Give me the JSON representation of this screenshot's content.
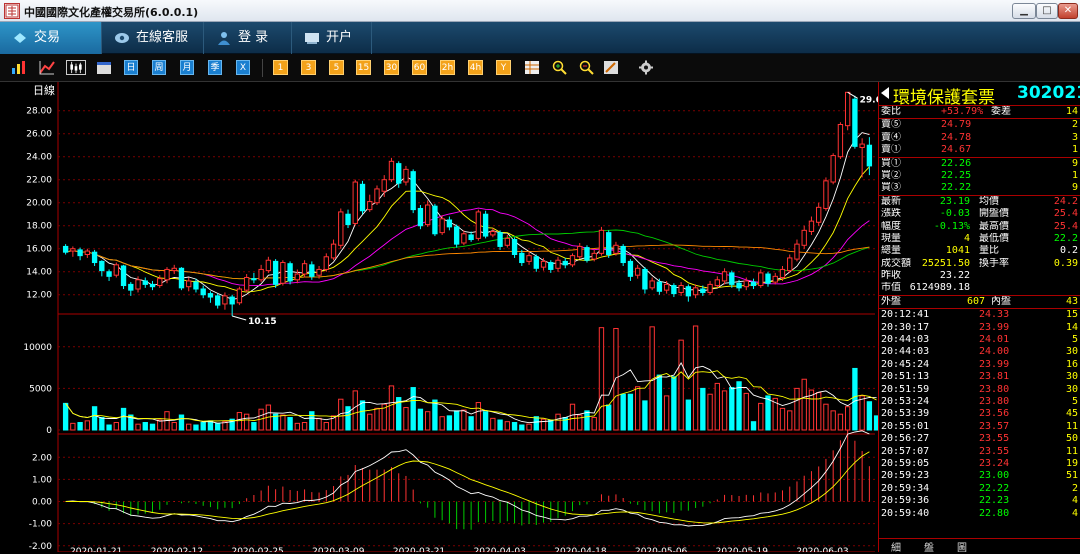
{
  "window": {
    "title": "中國國際文化產權交易所(6.0.0.1)",
    "logo_text": "文交所"
  },
  "nav": [
    {
      "label": "交易",
      "icon": "trade-icon",
      "active": true
    },
    {
      "label": "在線客服",
      "icon": "support-icon",
      "active": false
    },
    {
      "label": "登  录",
      "icon": "user-icon",
      "active": false
    },
    {
      "label": "开户",
      "icon": "account-icon",
      "active": false
    }
  ],
  "toolbar": {
    "periods": [
      "日",
      "周",
      "月",
      "季",
      "X"
    ],
    "minutes": [
      "1",
      "3",
      "5",
      "15",
      "30",
      "60",
      "2h",
      "4h",
      "Y"
    ]
  },
  "chart_data": [
    {
      "type": "candlestick",
      "title": "日線",
      "period_label": "日線",
      "yticks": [
        "28.00",
        "26.00",
        "24.00",
        "22.00",
        "20.00",
        "18.00",
        "16.00",
        "14.00",
        "12.00"
      ],
      "ylim": [
        10.5,
        29.8
      ],
      "x_dates": [
        "2020-01-21",
        "2020-02-12",
        "2020-02-25",
        "2020-03-09",
        "2020-03-21",
        "2020-04-03",
        "2020-04-18",
        "2020-05-06",
        "2020-05-19",
        "2020-06-03"
      ],
      "annotations": {
        "high": "29.6",
        "low": "10.15"
      },
      "candles": [
        [
          16.2,
          15.7,
          16.4,
          15.5
        ],
        [
          15.8,
          16.0,
          16.2,
          15.3
        ],
        [
          15.9,
          15.4,
          16.1,
          15.0
        ],
        [
          15.5,
          15.8,
          16.0,
          15.2
        ],
        [
          15.7,
          14.8,
          15.9,
          14.5
        ],
        [
          14.9,
          14.1,
          15.0,
          13.6
        ],
        [
          14.0,
          13.6,
          14.2,
          13.2
        ],
        [
          13.7,
          14.6,
          14.8,
          13.5
        ],
        [
          14.5,
          12.8,
          14.6,
          12.5
        ],
        [
          12.9,
          12.4,
          13.1,
          11.9
        ],
        [
          12.5,
          13.3,
          13.6,
          12.2
        ],
        [
          13.2,
          12.9,
          13.5,
          12.6
        ],
        [
          12.9,
          12.7,
          13.2,
          12.4
        ],
        [
          12.8,
          13.4,
          13.7,
          12.6
        ],
        [
          13.3,
          14.2,
          14.4,
          13.0
        ],
        [
          14.1,
          14.3,
          14.6,
          13.8
        ],
        [
          14.3,
          12.6,
          14.4,
          12.4
        ],
        [
          12.7,
          13.2,
          13.5,
          12.3
        ],
        [
          13.1,
          12.5,
          13.4,
          12.2
        ],
        [
          12.5,
          12.0,
          12.8,
          11.7
        ],
        [
          12.1,
          11.8,
          12.3,
          11.3
        ],
        [
          11.9,
          11.1,
          12.1,
          10.8
        ],
        [
          11.2,
          11.9,
          12.2,
          10.7
        ],
        [
          11.8,
          11.2,
          12.0,
          10.15
        ],
        [
          11.3,
          12.5,
          12.7,
          11.1
        ],
        [
          12.4,
          13.5,
          13.8,
          12.2
        ],
        [
          13.4,
          13.3,
          13.9,
          13.0
        ],
        [
          13.3,
          14.2,
          14.6,
          13.1
        ],
        [
          14.1,
          15.0,
          15.3,
          13.9
        ],
        [
          14.9,
          12.9,
          15.1,
          12.6
        ],
        [
          13.0,
          14.8,
          15.0,
          12.8
        ],
        [
          14.7,
          13.2,
          14.9,
          12.9
        ],
        [
          13.3,
          13.8,
          14.2,
          13.0
        ],
        [
          13.8,
          14.7,
          15.0,
          13.5
        ],
        [
          14.6,
          13.6,
          14.9,
          13.3
        ],
        [
          13.7,
          14.2,
          14.5,
          13.4
        ],
        [
          14.2,
          15.3,
          15.6,
          14.0
        ],
        [
          15.2,
          16.4,
          16.8,
          15.0
        ],
        [
          16.3,
          19.2,
          19.5,
          16.0
        ],
        [
          19.0,
          18.1,
          19.4,
          17.8
        ],
        [
          18.2,
          21.8,
          22.0,
          18.0
        ],
        [
          21.6,
          19.3,
          21.9,
          19.0
        ],
        [
          19.4,
          20.1,
          20.7,
          19.2
        ],
        [
          20.0,
          21.2,
          21.5,
          19.8
        ],
        [
          21.0,
          22.0,
          22.4,
          20.5
        ],
        [
          22.0,
          23.6,
          23.9,
          21.8
        ],
        [
          23.4,
          21.7,
          23.6,
          21.3
        ],
        [
          21.8,
          22.9,
          23.2,
          21.5
        ],
        [
          22.7,
          19.4,
          22.9,
          19.1
        ],
        [
          19.5,
          18.0,
          19.8,
          17.7
        ],
        [
          18.1,
          19.8,
          20.2,
          17.9
        ],
        [
          19.7,
          17.3,
          19.9,
          17.1
        ],
        [
          17.4,
          18.6,
          18.9,
          17.2
        ],
        [
          18.5,
          17.9,
          18.8,
          17.6
        ],
        [
          17.9,
          16.4,
          18.1,
          16.1
        ],
        [
          16.5,
          17.3,
          17.6,
          16.3
        ],
        [
          17.2,
          16.8,
          17.5,
          16.6
        ],
        [
          16.9,
          19.2,
          19.4,
          16.7
        ],
        [
          19.0,
          17.1,
          19.3,
          16.9
        ],
        [
          17.2,
          17.5,
          17.8,
          17.0
        ],
        [
          17.4,
          16.2,
          17.6,
          15.9
        ],
        [
          16.3,
          16.9,
          17.2,
          16.1
        ],
        [
          16.8,
          15.5,
          17.0,
          15.2
        ],
        [
          15.6,
          14.8,
          15.9,
          14.5
        ],
        [
          14.9,
          15.4,
          15.7,
          14.6
        ],
        [
          15.3,
          14.3,
          15.5,
          14.0
        ],
        [
          14.4,
          14.9,
          15.2,
          14.1
        ],
        [
          14.8,
          14.2,
          15.0,
          13.9
        ],
        [
          14.3,
          15.0,
          15.3,
          14.0
        ],
        [
          14.9,
          14.6,
          15.2,
          14.3
        ],
        [
          14.6,
          15.4,
          15.6,
          14.4
        ],
        [
          15.3,
          16.2,
          16.5,
          15.1
        ],
        [
          16.1,
          15.0,
          16.3,
          14.8
        ],
        [
          15.1,
          15.6,
          15.9,
          14.9
        ],
        [
          15.6,
          17.6,
          17.9,
          15.4
        ],
        [
          17.4,
          15.5,
          17.6,
          15.2
        ],
        [
          15.6,
          16.3,
          16.6,
          15.4
        ],
        [
          16.2,
          14.8,
          16.4,
          14.5
        ],
        [
          14.9,
          13.6,
          15.1,
          13.2
        ],
        [
          13.7,
          14.3,
          14.6,
          13.4
        ],
        [
          14.2,
          12.5,
          14.4,
          12.1
        ],
        [
          12.6,
          13.2,
          13.5,
          12.4
        ],
        [
          13.1,
          12.3,
          13.4,
          12.0
        ],
        [
          12.4,
          12.9,
          13.2,
          12.1
        ],
        [
          12.8,
          12.1,
          13.0,
          11.8
        ],
        [
          12.2,
          12.8,
          13.1,
          11.9
        ],
        [
          12.7,
          11.9,
          12.9,
          11.4
        ],
        [
          12.0,
          12.6,
          12.9,
          11.7
        ],
        [
          12.5,
          12.2,
          12.8,
          11.9
        ],
        [
          12.2,
          12.9,
          13.2,
          12.0
        ],
        [
          12.8,
          13.3,
          13.6,
          12.6
        ],
        [
          13.2,
          14.0,
          14.3,
          12.9
        ],
        [
          13.9,
          12.9,
          14.1,
          12.6
        ],
        [
          13.0,
          12.6,
          13.3,
          12.3
        ],
        [
          12.7,
          13.2,
          13.5,
          12.4
        ],
        [
          13.1,
          12.8,
          13.4,
          12.5
        ],
        [
          12.8,
          13.9,
          14.2,
          12.6
        ],
        [
          13.8,
          13.0,
          14.0,
          12.7
        ],
        [
          13.1,
          13.6,
          13.9,
          12.9
        ],
        [
          13.5,
          14.2,
          14.5,
          13.2
        ],
        [
          14.1,
          15.2,
          15.5,
          13.9
        ],
        [
          15.1,
          16.4,
          16.8,
          14.9
        ],
        [
          16.3,
          17.6,
          18.0,
          16.0
        ],
        [
          17.5,
          18.4,
          18.8,
          17.2
        ],
        [
          18.3,
          19.6,
          20.0,
          18.0
        ],
        [
          19.5,
          21.9,
          22.2,
          19.3
        ],
        [
          21.8,
          24.1,
          24.3,
          21.6
        ],
        [
          24.0,
          26.8,
          27.0,
          23.8
        ],
        [
          26.7,
          29.6,
          29.6,
          26.3
        ],
        [
          29.0,
          24.9,
          29.3,
          24.7
        ],
        [
          24.8,
          25.1,
          25.6,
          22.2
        ],
        [
          25.0,
          23.2,
          25.7,
          22.4
        ]
      ],
      "ma_lines": {
        "MA5": "#ffffff",
        "MA10": "#ffff00",
        "MA20": "#ff00ff",
        "MA60": "#00ff00",
        "MA120": "#ff8800"
      }
    },
    {
      "type": "bar",
      "title": "VOL",
      "yticks": [
        "10000",
        "5000",
        "0"
      ],
      "ylim": [
        0,
        12500
      ],
      "values": [
        3200,
        800,
        900,
        1100,
        2800,
        1500,
        600,
        900,
        2600,
        1800,
        700,
        900,
        700,
        1200,
        2200,
        900,
        1800,
        700,
        600,
        900,
        1100,
        800,
        1000,
        1300,
        2100,
        1900,
        900,
        2500,
        3000,
        1900,
        1800,
        1500,
        800,
        900,
        2200,
        1400,
        900,
        1700,
        3700,
        2800,
        4700,
        3500,
        1900,
        2600,
        3100,
        5300,
        3900,
        2700,
        5100,
        2500,
        2200,
        3600,
        1600,
        1700,
        2300,
        2400,
        1600,
        3300,
        2200,
        1400,
        1200,
        1000,
        900,
        600,
        700,
        1600,
        1300,
        1200,
        1900,
        1500,
        3100,
        1800,
        2300,
        1500,
        12300,
        3000,
        12200,
        4300,
        4300,
        5200,
        3500,
        12400,
        6600,
        4100,
        6400,
        10800,
        3600,
        12500,
        5000,
        4300,
        5600,
        4700,
        5100,
        5800,
        4400,
        1000,
        3200,
        4100,
        3800,
        2600,
        2300,
        5000,
        6100,
        4800,
        4500,
        3100,
        2300,
        1900,
        2800,
        7400,
        4100,
        3400,
        1700
      ],
      "up": [
        0,
        1,
        0,
        1,
        0,
        0,
        0,
        1,
        0,
        0,
        1,
        0,
        0,
        1,
        1,
        1,
        0,
        1,
        0,
        0,
        0,
        0,
        1,
        0,
        1,
        1,
        0,
        1,
        1,
        0,
        1,
        0,
        1,
        1,
        0,
        1,
        1,
        1,
        1,
        0,
        1,
        0,
        1,
        1,
        1,
        1,
        0,
        1,
        0,
        0,
        1,
        0,
        1,
        0,
        0,
        1,
        0,
        1,
        0,
        1,
        0,
        1,
        0,
        0,
        1,
        0,
        1,
        0,
        1,
        0,
        1,
        1,
        0,
        1,
        1,
        0,
        1,
        0,
        0,
        1,
        0,
        1,
        0,
        1,
        0,
        1,
        0,
        1,
        0,
        1,
        1,
        1,
        0,
        0,
        1,
        0,
        1,
        0,
        1,
        1,
        1,
        1,
        1,
        1,
        1,
        1,
        1,
        1,
        1,
        0,
        1,
        0
      ]
    },
    {
      "type": "line",
      "title": "MACD",
      "yticks": [
        "2.00",
        "1.00",
        "0.00",
        "-1.00",
        "-2.00"
      ],
      "ylim": [
        -2.1,
        2.6
      ]
    }
  ],
  "quote": {
    "name": "環境保護套票",
    "code": "302021",
    "ratio": {
      "label": "委比",
      "value": "+53.79%",
      "label2": "委差",
      "value2": "14"
    },
    "asks": [
      {
        "label": "賣⑤",
        "price": "24.79",
        "vol": "2"
      },
      {
        "label": "賣④",
        "price": "24.78",
        "vol": "3"
      },
      {
        "label": "賣①",
        "price": "24.67",
        "vol": "1"
      }
    ],
    "bids": [
      {
        "label": "買①",
        "price": "22.26",
        "vol": "9"
      },
      {
        "label": "買②",
        "price": "22.25",
        "vol": "1"
      },
      {
        "label": "買③",
        "price": "22.22",
        "vol": "9"
      }
    ],
    "stats": [
      {
        "l1": "最新",
        "v1": "23.19",
        "l2": "均價",
        "v2": "24.2",
        "c1": "#00ff00",
        "c2": "#ff3333"
      },
      {
        "l1": "漲跌",
        "v1": "-0.03",
        "l2": "開盤價",
        "v2": "25.4",
        "c1": "#00ff00",
        "c2": "#ff3333"
      },
      {
        "l1": "幅度",
        "v1": "-0.13%",
        "l2": "最高價",
        "v2": "25.4",
        "c1": "#00ff00",
        "c2": "#ff3333"
      },
      {
        "l1": "現量",
        "v1": "4",
        "l2": "最低價",
        "v2": "22.2",
        "c1": "#ffff00",
        "c2": "#00ff00"
      },
      {
        "l1": "總量",
        "v1": "1041",
        "l2": "量比",
        "v2": "0.2",
        "c1": "#ffff00",
        "c2": "#ffffff"
      },
      {
        "l1": "成交額",
        "v1": "25251.50",
        "l2": "換手率",
        "v2": "0.39",
        "c1": "#ffff00",
        "c2": "#ffff00"
      },
      {
        "l1": "昨收",
        "v1": "23.22",
        "l2": "",
        "v2": "",
        "c1": "#ffffff",
        "c2": "#ffffff"
      },
      {
        "l1": "市值",
        "v1": "6124989.18",
        "l2": "",
        "v2": "",
        "c1": "#ffffff",
        "c2": "#ffffff"
      }
    ],
    "outer": {
      "label": "外盤",
      "value": "607",
      "label2": "內盤",
      "value2": "43"
    },
    "ticks": [
      {
        "t": "20:12:41",
        "p": "24.33",
        "v": "15",
        "c": "#ff3333"
      },
      {
        "t": "20:30:17",
        "p": "23.99",
        "v": "14",
        "c": "#ff3333"
      },
      {
        "t": "20:44:03",
        "p": "24.01",
        "v": "5",
        "c": "#ff3333"
      },
      {
        "t": "20:44:03",
        "p": "24.00",
        "v": "30",
        "c": "#ff3333"
      },
      {
        "t": "20:45:24",
        "p": "23.99",
        "v": "16",
        "c": "#ff3333"
      },
      {
        "t": "20:51:13",
        "p": "23.81",
        "v": "30",
        "c": "#ff3333"
      },
      {
        "t": "20:51:59",
        "p": "23.80",
        "v": "30",
        "c": "#ff3333"
      },
      {
        "t": "20:53:24",
        "p": "23.80",
        "v": "5",
        "c": "#ff3333"
      },
      {
        "t": "20:53:39",
        "p": "23.56",
        "v": "45",
        "c": "#ff3333"
      },
      {
        "t": "20:55:01",
        "p": "23.57",
        "v": "11",
        "c": "#ff3333"
      },
      {
        "t": "20:56:27",
        "p": "23.55",
        "v": "50",
        "c": "#ff3333"
      },
      {
        "t": "20:57:07",
        "p": "23.55",
        "v": "11",
        "c": "#ff3333"
      },
      {
        "t": "20:59:05",
        "p": "23.24",
        "v": "19",
        "c": "#ff3333"
      },
      {
        "t": "20:59:23",
        "p": "23.00",
        "v": "51",
        "c": "#00ff00"
      },
      {
        "t": "20:59:34",
        "p": "22.22",
        "v": "2",
        "c": "#00ff00"
      },
      {
        "t": "20:59:36",
        "p": "22.23",
        "v": "4",
        "c": "#00ff00"
      },
      {
        "t": "20:59:40",
        "p": "22.80",
        "v": "4",
        "c": "#00ff00"
      }
    ],
    "tabs": [
      "細",
      "盤",
      "圖"
    ]
  }
}
